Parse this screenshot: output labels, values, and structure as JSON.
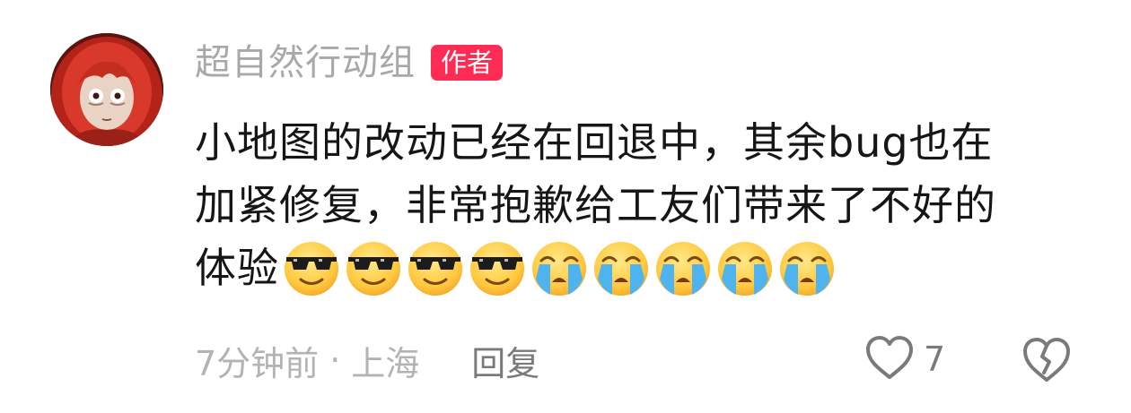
{
  "comment": {
    "username": "超自然行动组",
    "author_badge": "作者",
    "lines": [
      "小地图的改动已经在回退中，其余bug也在",
      "加紧修复，非常抱歉给工友们带来了不好的",
      "体验"
    ],
    "emojis": [
      "sunglasses-smile-emoji",
      "sunglasses-smile-emoji",
      "sunglasses-smile-emoji",
      "sunglasses-smile-emoji",
      "crying-emoji",
      "crying-emoji",
      "crying-emoji",
      "crying-emoji",
      "crying-emoji"
    ],
    "time": "7分钟前",
    "separator": "·",
    "location": "上海",
    "reply_label": "回复",
    "like_count": "7"
  },
  "icons": {
    "like": "heart-outline-icon",
    "dislike": "broken-heart-icon"
  },
  "colors": {
    "badge": "#fe2c55",
    "username": "#a8a8a8",
    "text": "#161616",
    "meta": "#b3b3b3"
  }
}
